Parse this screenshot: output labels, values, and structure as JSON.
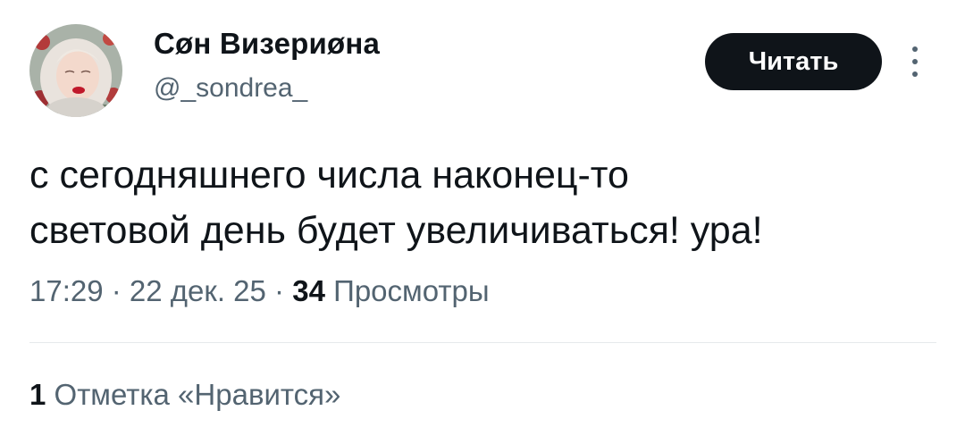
{
  "author": {
    "display_name": "Сøн Визериøна",
    "handle": "@_sondrea_",
    "avatar_icon": "profile-photo"
  },
  "follow_button": {
    "label": "Читать"
  },
  "more_icon": "vertical-ellipsis-icon",
  "tweet": {
    "lines": [
      "с сегодняшнего числа наконец-то",
      "световой день будет увеличиваться! ура!"
    ]
  },
  "meta": {
    "time": "17:29",
    "separator": " · ",
    "date": "22 дек. 25",
    "views_count": "34",
    "views_label": " Просмотры"
  },
  "likes": {
    "count": "1",
    "label": " Отметка «Нравится»"
  },
  "colors": {
    "text": "#0f1419",
    "secondary": "#536471",
    "button_bg": "#0f1419",
    "button_text": "#ffffff",
    "divider": "#e6e9ec"
  }
}
